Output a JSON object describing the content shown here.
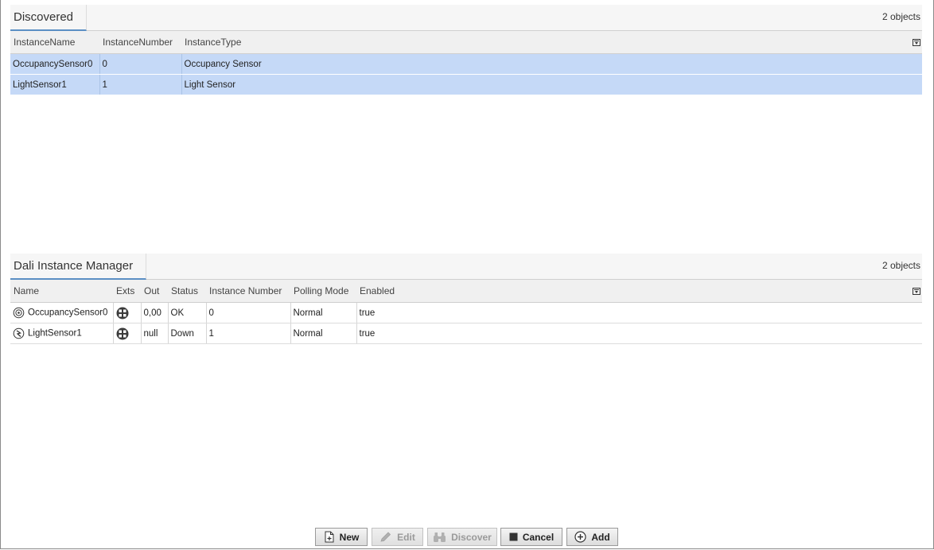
{
  "discovered": {
    "title": "Discovered",
    "count": "2 objects",
    "columns": [
      "InstanceName",
      "InstanceNumber",
      "InstanceType"
    ],
    "rows": [
      {
        "name": "OccupancySensor0",
        "number": "0",
        "type": "Occupancy Sensor"
      },
      {
        "name": "LightSensor1",
        "number": "1",
        "type": "Light Sensor"
      }
    ]
  },
  "manager": {
    "title": "Dali Instance Manager",
    "count": "2 objects",
    "columns": [
      "Name",
      "Exts",
      "Out",
      "Status",
      "Instance Number",
      "Polling Mode",
      "Enabled"
    ],
    "rows": [
      {
        "name": "OccupancySensor0",
        "exts_icon": "exts-icon",
        "out": "0,00",
        "status": "OK",
        "instance_number": "0",
        "polling_mode": "Normal",
        "enabled": "true"
      },
      {
        "name": "LightSensor1",
        "exts_icon": "exts-icon",
        "out": "null",
        "status": "Down",
        "instance_number": "1",
        "polling_mode": "Normal",
        "enabled": "true"
      }
    ]
  },
  "buttons": {
    "new": "New",
    "edit": "Edit",
    "discover": "Discover",
    "cancel": "Cancel",
    "add": "Add"
  },
  "colors": {
    "selection": "#c5d9f7",
    "tab_underline": "#5b8fc4"
  }
}
